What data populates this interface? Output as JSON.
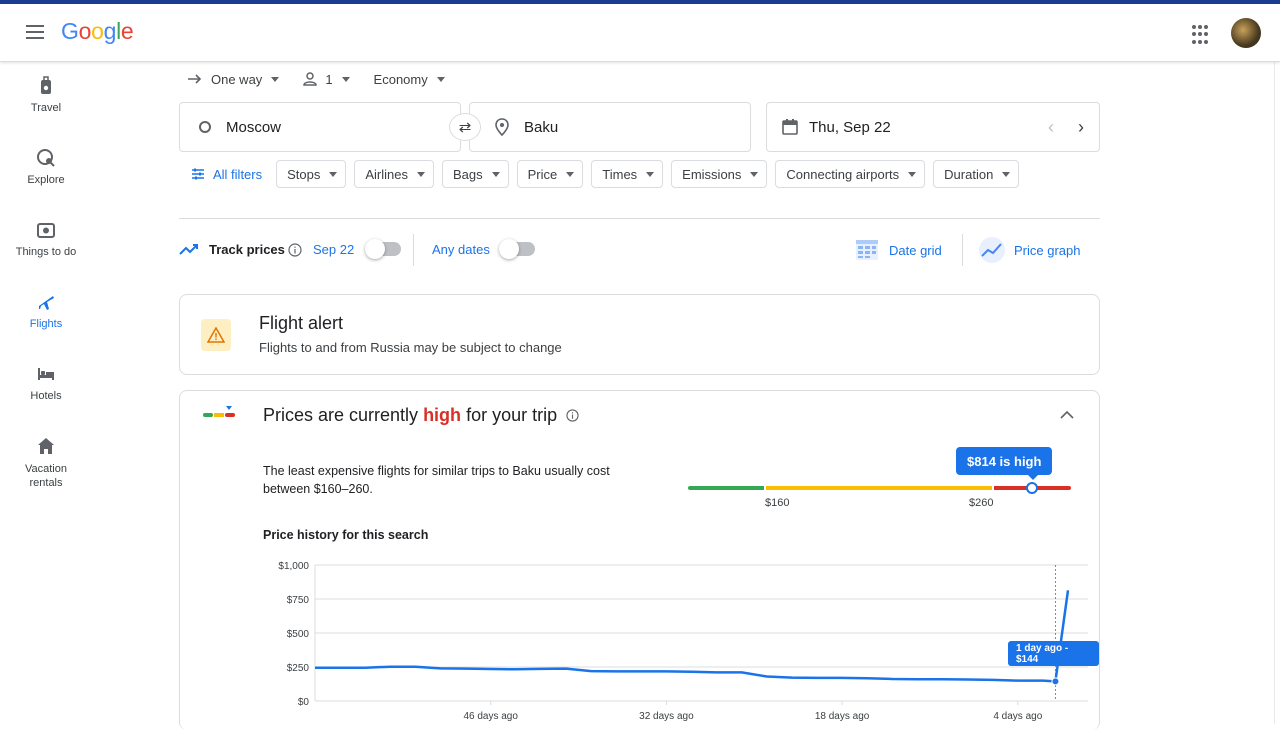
{
  "header": {
    "logo_letters": [
      {
        "ch": "G",
        "color": "#4285f4"
      },
      {
        "ch": "o",
        "color": "#ea4335"
      },
      {
        "ch": "o",
        "color": "#fbbc04"
      },
      {
        "ch": "g",
        "color": "#4285f4"
      },
      {
        "ch": "l",
        "color": "#34a853"
      },
      {
        "ch": "e",
        "color": "#ea4335"
      }
    ]
  },
  "sidebar": {
    "items": [
      {
        "label": "Travel",
        "icon": "luggage-icon",
        "active": false
      },
      {
        "label": "Explore",
        "icon": "explore-globe-icon",
        "active": false
      },
      {
        "label": "Things to do",
        "icon": "camera-icon",
        "active": false
      },
      {
        "label": "Flights",
        "icon": "airplane-icon",
        "active": true
      },
      {
        "label": "Hotels",
        "icon": "bed-icon",
        "active": false
      },
      {
        "label": "Vacation\nrentals",
        "icon": "house-icon",
        "active": false
      }
    ]
  },
  "search": {
    "trip_type": "One way",
    "passengers": "1",
    "cabin": "Economy",
    "origin": "Moscow",
    "destination": "Baku",
    "date": "Thu, Sep 22"
  },
  "filters": {
    "all_filters": "All filters",
    "chips": [
      "Stops",
      "Airlines",
      "Bags",
      "Price",
      "Times",
      "Emissions",
      "Connecting airports",
      "Duration"
    ]
  },
  "track": {
    "label": "Track prices",
    "date": "Sep 22",
    "any_dates": "Any dates",
    "date_grid": "Date grid",
    "price_graph": "Price graph"
  },
  "alert": {
    "title": "Flight alert",
    "text": "Flights to and from Russia may be subject to change"
  },
  "insight": {
    "title_pre": "Prices are currently ",
    "title_level": "high",
    "title_post": " for your trip",
    "desc_line1": "The least expensive flights for similar trips to Baku usually cost",
    "desc_line2": "between $160–260.",
    "badge_price": "$814 is ",
    "badge_level": "high",
    "range_low": "$160",
    "range_high": "$260",
    "history_title": "Price history for this search",
    "tooltip": "1 day ago - $144"
  },
  "colors": {
    "accent": "#1a73e8",
    "high": "#d93025",
    "low": "#34a853",
    "typical": "#fbbc04"
  },
  "chart_data": {
    "type": "line",
    "ylabel_ticks": [
      "$0",
      "$250",
      "$500",
      "$750",
      "$1,000"
    ],
    "ylim": [
      0,
      1000
    ],
    "x_tick_labels": [
      "46 days ago",
      "32 days ago",
      "18 days ago",
      "4 days ago"
    ],
    "x_ticks_days_ago": [
      46,
      32,
      18,
      4
    ],
    "xlim_days_ago": [
      60,
      0
    ],
    "grid": true,
    "series": [
      {
        "days_ago": [
          60,
          58,
          56,
          54,
          52,
          50,
          48,
          46,
          44,
          42,
          40,
          38,
          36,
          34,
          32,
          30,
          28,
          26,
          24,
          22,
          20,
          18,
          16,
          14,
          12,
          10,
          8,
          6,
          4,
          2,
          1,
          0
        ],
        "values": [
          245,
          245,
          245,
          252,
          252,
          240,
          238,
          235,
          233,
          236,
          238,
          220,
          218,
          218,
          218,
          215,
          210,
          210,
          180,
          172,
          170,
          170,
          168,
          162,
          160,
          160,
          158,
          155,
          150,
          150,
          144,
          814
        ]
      }
    ]
  }
}
